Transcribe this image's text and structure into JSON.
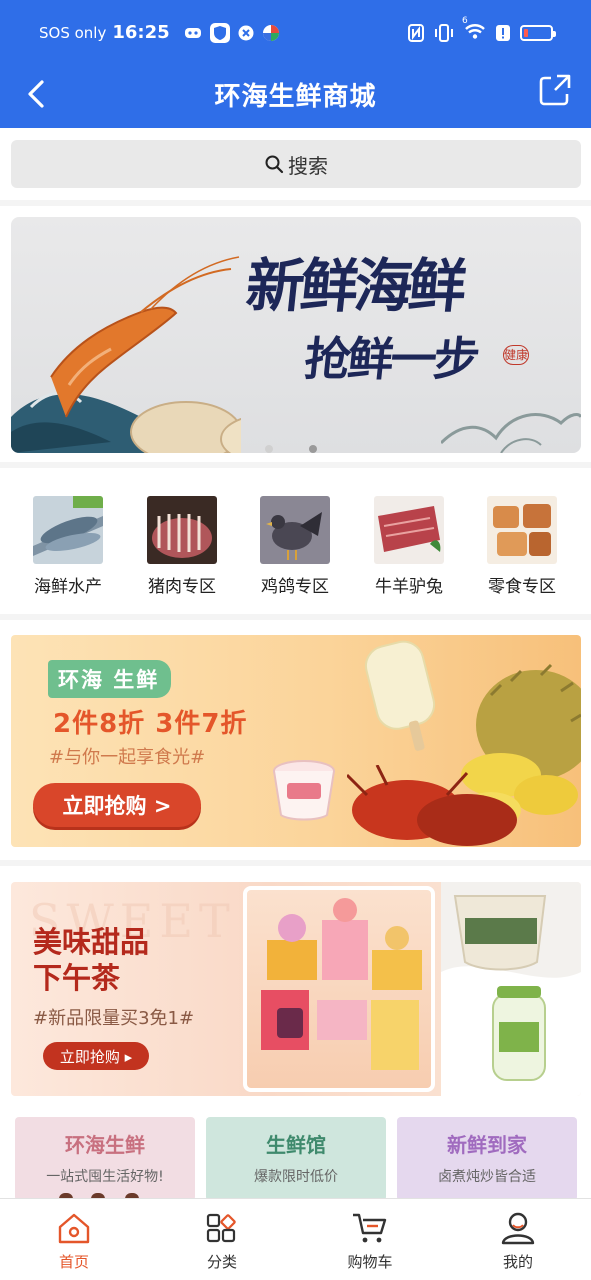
{
  "status_bar": {
    "carrier": "SOS only",
    "time": "16:25",
    "icons": [
      "game-icon",
      "shield-icon",
      "close-icon",
      "app-icon"
    ],
    "right_icons": [
      "nfc-icon",
      "vibrate-icon",
      "wifi-icon",
      "alert-icon",
      "battery-icon"
    ],
    "wifi_badge": "6",
    "battery_level": 0.15
  },
  "header": {
    "title": "环海生鲜商城"
  },
  "search": {
    "label": "搜索"
  },
  "banner": {
    "headline": "新鲜海鲜",
    "subline": "抢鲜一步",
    "seal": "健康",
    "slide_count": 2,
    "active_slide": 1
  },
  "categories": [
    {
      "label": "海鲜水产",
      "color": "#8fa4b6"
    },
    {
      "label": "猪肉专区",
      "color": "#b0565a"
    },
    {
      "label": "鸡鸽专区",
      "color": "#6e6a78"
    },
    {
      "label": "牛羊驴兔",
      "color": "#b8424a"
    },
    {
      "label": "零食专区",
      "color": "#d88b4a"
    }
  ],
  "promo1": {
    "tag": "环海 生鲜",
    "offer": "2件8折  3件7折",
    "hashtag": "#与你一起享食光#",
    "button": "立即抢购 >"
  },
  "promo2": {
    "watermark": "SWEET",
    "title_line1": "美味甜品",
    "title_line2": "下午茶",
    "hashtag": "#新品限量买3免1#",
    "button": "立即抢购 ▸"
  },
  "tiles": [
    {
      "title": "环海生鲜",
      "subtitle": "一站式囤生活好物!",
      "bg": "#f2dde3",
      "color": "#c8707f"
    },
    {
      "title": "生鲜馆",
      "subtitle": "爆款限时低价",
      "bg": "#cfe6dd",
      "color": "#3f8a6d"
    },
    {
      "title": "新鲜到家",
      "subtitle": "卤煮炖炒皆合适",
      "bg": "#e5d8ee",
      "color": "#a06bbf"
    }
  ],
  "tabbar": {
    "items": [
      {
        "label": "首页",
        "icon": "home-icon",
        "active": true
      },
      {
        "label": "分类",
        "icon": "category-icon",
        "active": false
      },
      {
        "label": "购物车",
        "icon": "cart-icon",
        "active": false
      },
      {
        "label": "我的",
        "icon": "user-icon",
        "active": false
      }
    ]
  },
  "colors": {
    "primary": "#2f6ee8",
    "accent": "#e4562a"
  }
}
